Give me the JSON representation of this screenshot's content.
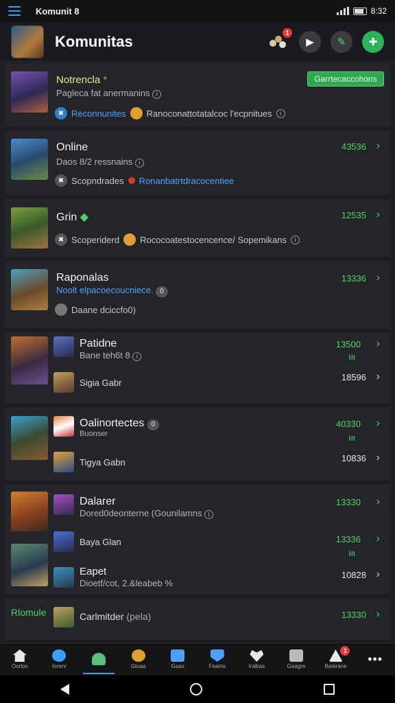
{
  "status_bar": {
    "title": "Komunit 8",
    "time": "8:32"
  },
  "app_bar": {
    "title": "Komunitas",
    "notification_count": "1"
  },
  "communities": [
    {
      "title": "Notrencla",
      "title_mark": "*",
      "subtitle": "Pagleca fat anermanins",
      "meta": "Reconnunites",
      "meta_link": "Ranoconattotatalcoc l'ecpnitues",
      "button": "Garrtecaccohons"
    },
    {
      "title": "Online",
      "subtitle": "Daos 8/2 ressnains",
      "meta_prefix": "Scopndrades",
      "meta_link": "Ronanbatrtdracocentiee",
      "count": "43536"
    },
    {
      "title": "Grin",
      "subtitle": "",
      "meta": "Scoperiderd",
      "meta_text": "Rococoatestocencence/ Sopemikans",
      "count": "12535"
    },
    {
      "title": "Raponalas",
      "subtitle": "Noolt elpacoecoucniece.",
      "pill": "0",
      "meta": "Daane dciccfo0)",
      "count": "13336"
    },
    {
      "title": "Patidne",
      "subtitle": "Bane teh6t 8",
      "count": "13500",
      "count_sub": "lilt",
      "row2_label": "Sigia Gabr",
      "row2_count": "18596"
    },
    {
      "title": "Oalinortectes",
      "pill": "0",
      "subtitle": "Buonser",
      "count": "40330",
      "count_sub": "lilt",
      "row2_label": "Tigya Gabn",
      "row2_count": "10836"
    },
    {
      "title": "Dalarer",
      "subtitle": "Dored0deonterne (Gounilamns",
      "count": "13330",
      "row2_label": "Baya Glan",
      "row2_count": "13336",
      "row2_count_sub": "lilt",
      "row3_label": "Eapet",
      "row3_sub": "Dioetf/cot, 2.&leabeb %",
      "row3_count": "10828"
    },
    {
      "title": "Rlomule",
      "row_label": "Carlmitder",
      "row_paren": "(pela)",
      "count": "13330"
    }
  ],
  "nav": [
    {
      "label": "Oorlos",
      "color": "#e8e8e8"
    },
    {
      "label": "Iorenr",
      "color": "#3aa0ff"
    },
    {
      "label": "",
      "color": "#5abf7a"
    },
    {
      "label": "Gtnaa",
      "color": "#e0a030"
    },
    {
      "label": "Gaas",
      "color": "#4ea2ff"
    },
    {
      "label": "Feams",
      "color": "#4ea2ff"
    },
    {
      "label": "Iralkas",
      "color": "#e8e8e8"
    },
    {
      "label": "Gaagre",
      "color": "#bbbbbb"
    },
    {
      "label": "Banirane",
      "color": "#e8e8e8"
    },
    {
      "label": "",
      "color": "#e8e8e8"
    }
  ],
  "nav_badge": "1"
}
